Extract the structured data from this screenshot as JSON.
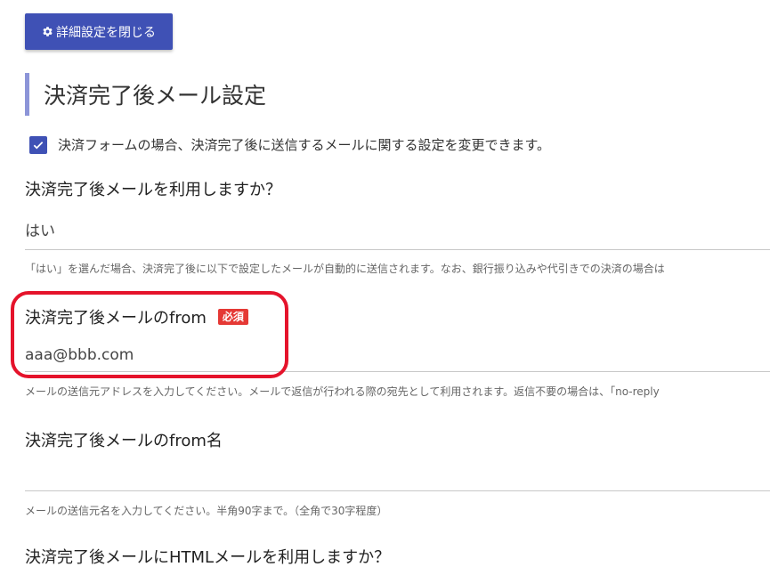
{
  "toolbar": {
    "close_label": "詳細設定を閉じる",
    "close_icon": "gear-icon"
  },
  "section": {
    "title": "決済完了後メール設定"
  },
  "info": {
    "text": "決済フォームの場合、決済完了後に送信するメールに関する設定を変更できます。"
  },
  "fields": {
    "use_mail": {
      "label": "決済完了後メールを利用しますか？",
      "value": "はい",
      "helper": "「はい」を選んだ場合、決済完了後に以下で設定したメールが自動的に送信されます。なお、銀行振り込みや代引きでの決済の場合は"
    },
    "from": {
      "label": "決済完了後メールのfrom",
      "required_badge": "必須",
      "value": "aaa@bbb.com",
      "helper": "メールの送信元アドレスを入力してください。メールで返信が行われる際の宛先として利用されます。返信不要の場合は、「no-reply"
    },
    "from_name": {
      "label": "決済完了後メールのfrom名",
      "value": "",
      "helper": "メールの送信元名を入力してください。半角90字まで。（全角で30字程度）"
    },
    "use_html": {
      "label": "決済完了後メールにHTMLメールを利用しますか？"
    }
  },
  "colors": {
    "primary": "#3f51b5",
    "accent_bar": "#8c95d8",
    "badge": "#e53935",
    "highlight": "#e5132b"
  }
}
